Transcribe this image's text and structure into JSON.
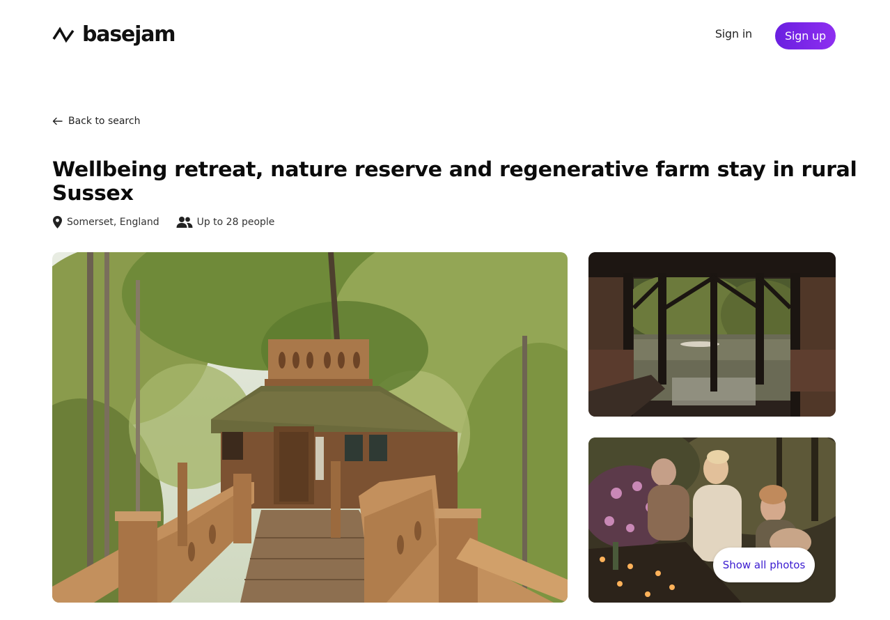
{
  "header": {
    "logo_text": "basejam",
    "logo_icon": "zigzag-logo-icon",
    "signin_label": "Sign in",
    "signup_label": "Sign up"
  },
  "nav": {
    "back_label": "Back to search",
    "back_icon": "arrow-left-icon"
  },
  "listing": {
    "title": "Wellbeing retreat, nature reserve and regenerative farm stay in rural Sussex",
    "location": "Somerset, England",
    "location_icon": "map-pin-icon",
    "capacity": "Up to 28 people",
    "capacity_icon": "people-icon"
  },
  "gallery": {
    "show_all_label": "Show all photos"
  },
  "colors": {
    "accent": "#7b24e8",
    "accent_text": "#3a1bd0",
    "text": "#1c1c1c"
  }
}
